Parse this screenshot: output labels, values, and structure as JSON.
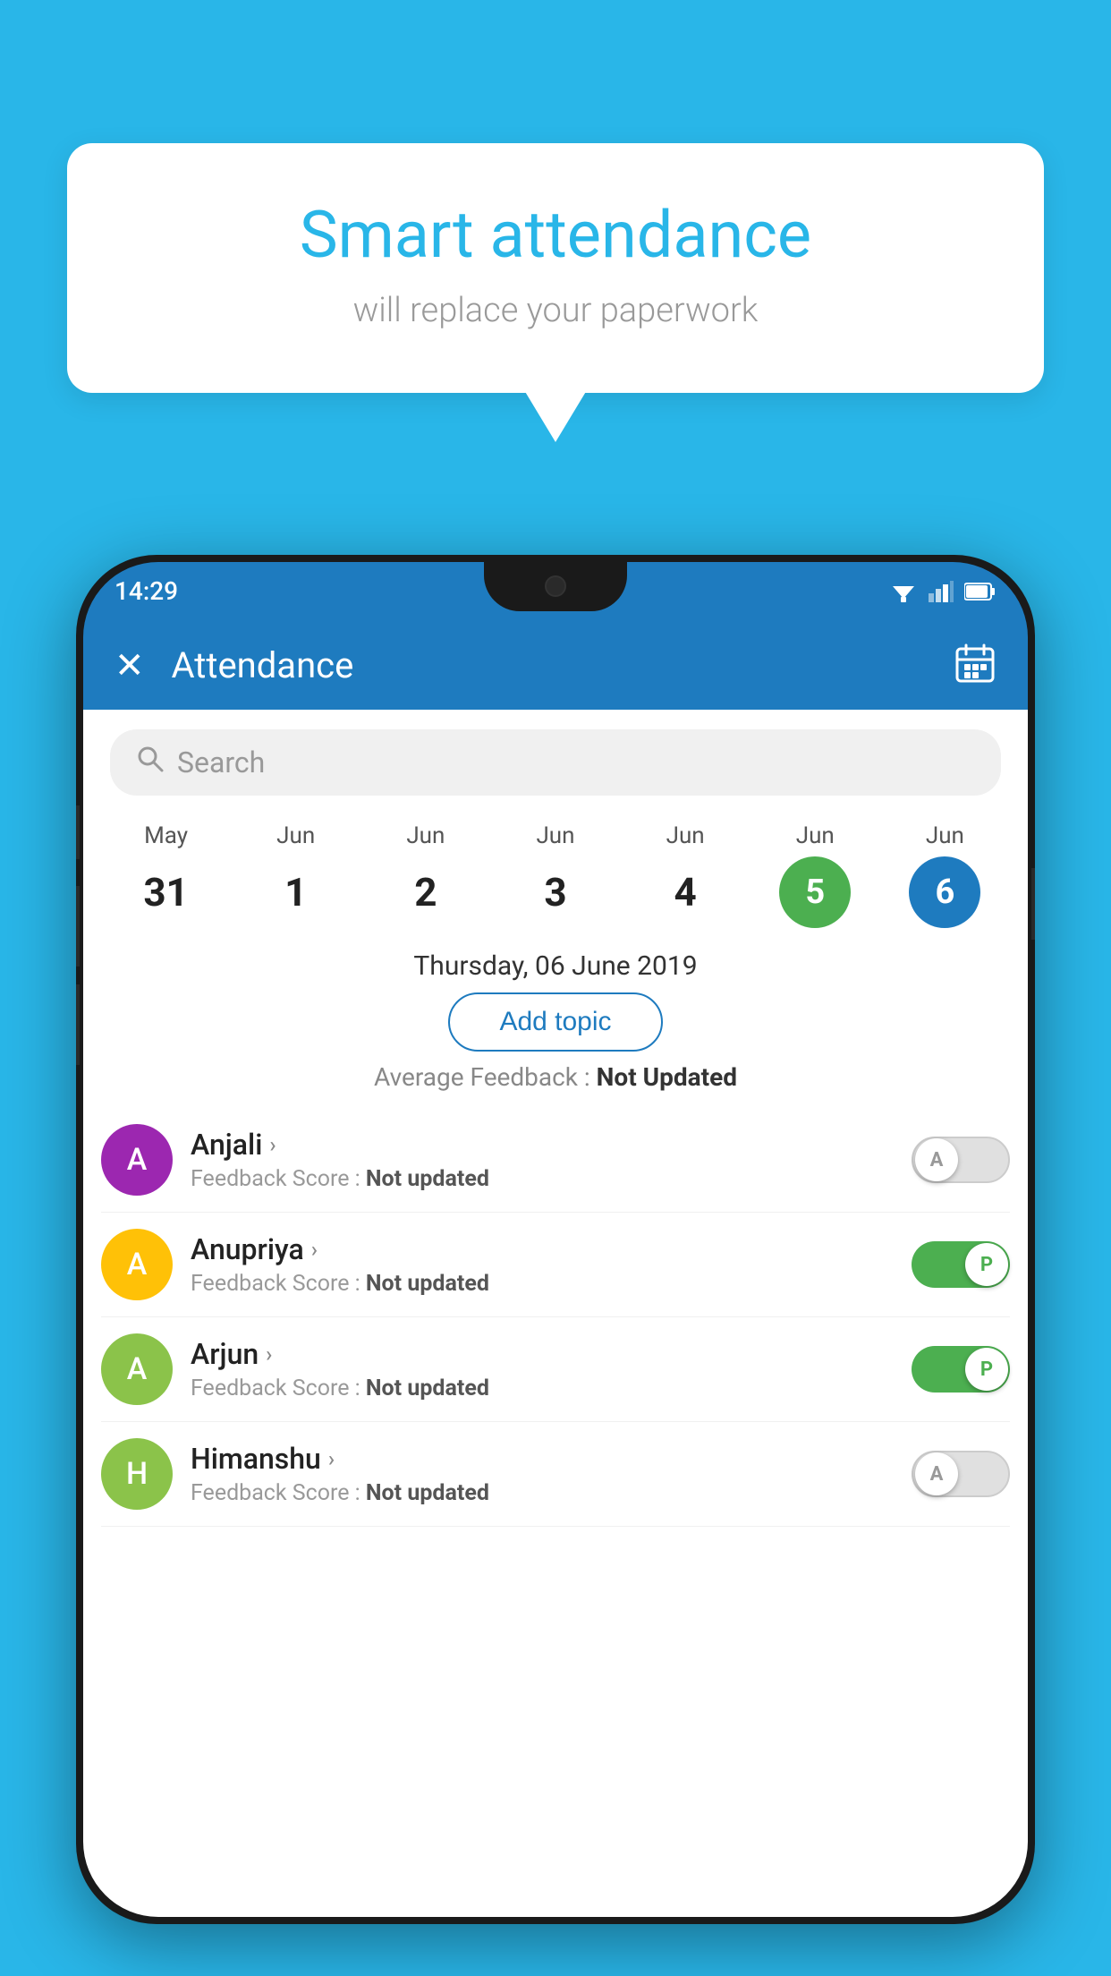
{
  "bubble": {
    "title": "Smart attendance",
    "subtitle": "will replace your paperwork"
  },
  "status_bar": {
    "time": "14:29"
  },
  "app_bar": {
    "title": "Attendance",
    "close_label": "✕"
  },
  "search": {
    "placeholder": "Search"
  },
  "calendar": {
    "days": [
      {
        "month": "May",
        "num": "31",
        "style": "normal"
      },
      {
        "month": "Jun",
        "num": "1",
        "style": "normal"
      },
      {
        "month": "Jun",
        "num": "2",
        "style": "normal"
      },
      {
        "month": "Jun",
        "num": "3",
        "style": "normal"
      },
      {
        "month": "Jun",
        "num": "4",
        "style": "normal"
      },
      {
        "month": "Jun",
        "num": "5",
        "style": "today"
      },
      {
        "month": "Jun",
        "num": "6",
        "style": "selected"
      }
    ],
    "selected_date": "Thursday, 06 June 2019"
  },
  "add_topic_label": "Add topic",
  "avg_feedback_label": "Average Feedback :",
  "avg_feedback_value": "Not Updated",
  "students": [
    {
      "name": "Anjali",
      "avatar_letter": "A",
      "avatar_color": "#9c27b0",
      "score_label": "Feedback Score :",
      "score_value": "Not updated",
      "toggle": "off",
      "toggle_letter": "A"
    },
    {
      "name": "Anupriya",
      "avatar_letter": "A",
      "avatar_color": "#ffc107",
      "score_label": "Feedback Score :",
      "score_value": "Not updated",
      "toggle": "on",
      "toggle_letter": "P"
    },
    {
      "name": "Arjun",
      "avatar_letter": "A",
      "avatar_color": "#8bc34a",
      "score_label": "Feedback Score :",
      "score_value": "Not updated",
      "toggle": "on",
      "toggle_letter": "P"
    },
    {
      "name": "Himanshu",
      "avatar_letter": "H",
      "avatar_color": "#8bc34a",
      "score_label": "Feedback Score :",
      "score_value": "Not updated",
      "toggle": "off",
      "toggle_letter": "A"
    }
  ]
}
